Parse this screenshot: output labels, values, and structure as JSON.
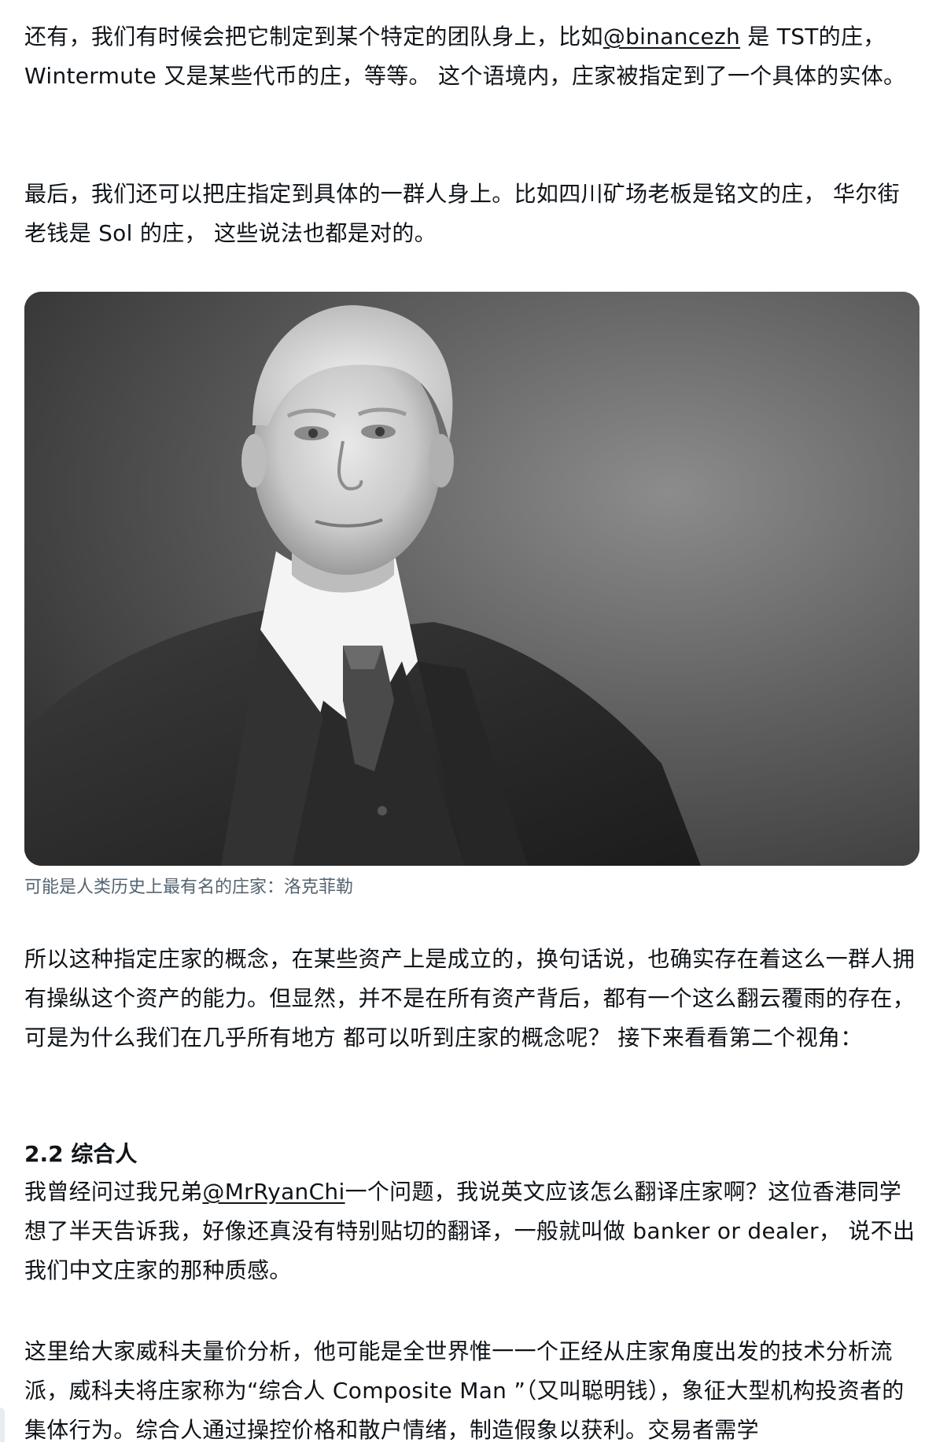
{
  "paragraphs": {
    "p1": {
      "before": "还有，我们有时候会把它制定到某个特定的团队身上，比如",
      "mention": "@binancezh",
      "after": " 是 TST的庄，Wintermute 又是某些代币的庄，等等。 这个语境内，庄家被指定到了一个具体的实体。"
    },
    "p2": "最后，我们还可以把庄指定到具体的一群人身上。比如四川矿场老板是铭文的庄， 华尔街老钱是 Sol 的庄， 这些说法也都是对的。",
    "p3": "所以这种指定庄家的概念，在某些资产上是成立的，换句话说，也确实存在着这么一群人拥有操纵这个资产的能力。但显然，并不是在所有资产背后，都有一个这么翻云覆雨的存在， 可是为什么我们在几乎所有地方 都可以听到庄家的概念呢？ 接下来看看第二个视角：",
    "heading": "2.2 综合人",
    "p4": {
      "before": "我曾经问过我兄弟",
      "mention": "@MrRyanChi",
      "after": "一个问题，我说英文应该怎么翻译庄家啊？这位香港同学想了半天告诉我，好像还真没有特别贴切的翻译，一般就叫做 banker or dealer， 说不出我们中文庄家的那种质感。"
    },
    "p5": "这里给大家威科夫量价分析，他可能是全世界惟一一个正经从庄家角度出发的技术分析流派，威科夫将庄家称为“综合人 Composite Man ”（又叫聪明钱），象征大型机构投资者的集体行为。综合人通过操控价格和散户情绪，制造假象以获利。交易者需学"
  },
  "figure": {
    "caption": "可能是人类历史上最有名的庄家：洛克菲勒",
    "image_description_icon": "portrait-photo"
  }
}
